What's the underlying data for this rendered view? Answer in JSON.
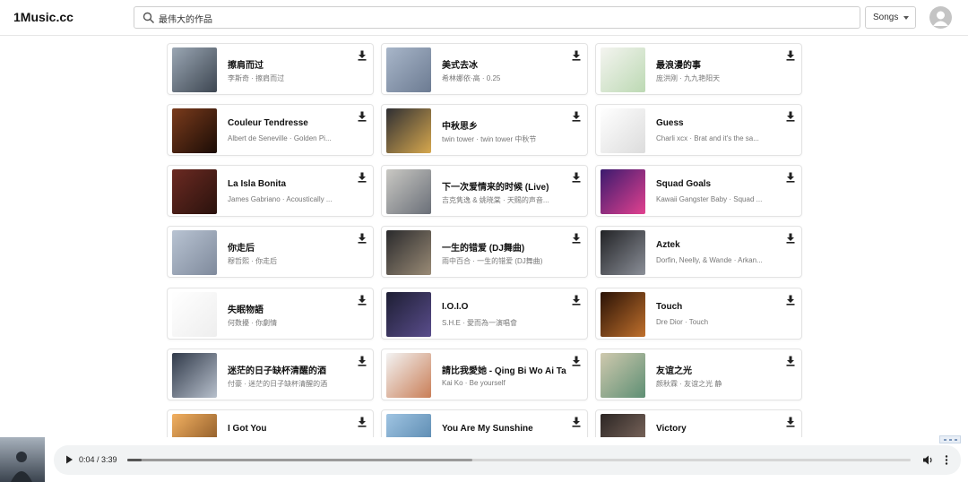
{
  "app": {
    "title": "1Music.cc"
  },
  "search": {
    "value": "最伟大的作品",
    "placeholder": ""
  },
  "type_select": {
    "selected": "Songs"
  },
  "results": [
    {
      "title": "擦肩而过",
      "subtitle": "李斯奇 · 擦肩而过",
      "thumb_colors": [
        "#9aa6b3",
        "#3d4651"
      ]
    },
    {
      "title": "美式去冰",
      "subtitle": "希林娜依·高 · 0.25",
      "thumb_colors": [
        "#a8b6c9",
        "#6c7b92"
      ]
    },
    {
      "title": "最浪漫的事",
      "subtitle": "庞洪刚 · 九九艳阳天",
      "thumb_colors": [
        "#f4f4f0",
        "#bcd9b3"
      ]
    },
    {
      "title": "Couleur Tendresse",
      "subtitle": "Albert de Seneville · Golden Pi...",
      "thumb_colors": [
        "#7a3b1c",
        "#1b0c06"
      ]
    },
    {
      "title": "中秋思乡",
      "subtitle": "twin tower · twin tower 中秋节",
      "thumb_colors": [
        "#2f2f33",
        "#d7a84e"
      ]
    },
    {
      "title": "Guess",
      "subtitle": "Charli xcx · Brat and it's the sa...",
      "thumb_colors": [
        "#ffffff",
        "#dcdcdc"
      ]
    },
    {
      "title": "La Isla Bonita",
      "subtitle": "James Gabriano · Acoustically ...",
      "thumb_colors": [
        "#6b2a22",
        "#2a120d"
      ]
    },
    {
      "title": "下一次爱情来的时候 (Live)",
      "subtitle": "吉克隽逸 & 姚晓棠 · 天赐的声音...",
      "thumb_colors": [
        "#c9c8c3",
        "#6a6f78"
      ]
    },
    {
      "title": "Squad Goals",
      "subtitle": "Kawaii Gangster Baby · Squad ...",
      "thumb_colors": [
        "#3b1a6e",
        "#e2418f"
      ]
    },
    {
      "title": "你走后",
      "subtitle": "穆哲熙 · 你走后",
      "thumb_colors": [
        "#b8c3d2",
        "#7f8a9c"
      ]
    },
    {
      "title": "一生的错爱 (DJ舞曲)",
      "subtitle": "雨中百合 · 一生的错爱 (DJ舞曲)",
      "thumb_colors": [
        "#2a2a2c",
        "#9a8b76"
      ]
    },
    {
      "title": "Aztek",
      "subtitle": "Dorfin, Neelly, & Wande · Arkan...",
      "thumb_colors": [
        "#222326",
        "#8b8f98"
      ]
    },
    {
      "title": "失眠物語",
      "subtitle": "何数擾 · 你劇情",
      "thumb_colors": [
        "#ffffff",
        "#eeeeee"
      ]
    },
    {
      "title": "I.O.I.O",
      "subtitle": "S.H.E · 愛而為一演唱會",
      "thumb_colors": [
        "#1d1e33",
        "#5a4d8c"
      ]
    },
    {
      "title": "Touch",
      "subtitle": "Dre Dior · Touch",
      "thumb_colors": [
        "#2a1206",
        "#c0702c"
      ]
    },
    {
      "title": "迷茫的日子缺杯清醒的酒",
      "subtitle": "付豪 · 迷茫的日子缺杯清醒的酒",
      "thumb_colors": [
        "#313a4a",
        "#b7c0cc"
      ]
    },
    {
      "title": "請比我愛她 - Qing Bi Wo Ai Ta",
      "subtitle": "Kai Ko · Be yourself",
      "thumb_colors": [
        "#f3f3f3",
        "#c97e57"
      ]
    },
    {
      "title": "友谊之光",
      "subtitle": "颜秋霖 · 友谊之光 静",
      "thumb_colors": [
        "#cfc9ae",
        "#5e8f74"
      ]
    },
    {
      "title": "I Got You",
      "subtitle": "",
      "thumb_colors": [
        "#f2b061",
        "#7a4a1d"
      ]
    },
    {
      "title": "You Are My Sunshine",
      "subtitle": "",
      "thumb_colors": [
        "#9fc4e2",
        "#4d7ea6"
      ]
    },
    {
      "title": "Victory",
      "subtitle": "",
      "thumb_colors": [
        "#2c2624",
        "#8c7468"
      ]
    }
  ],
  "player": {
    "time": "0:04 / 3:39",
    "progress": 0.018,
    "buffered": 0.44
  }
}
